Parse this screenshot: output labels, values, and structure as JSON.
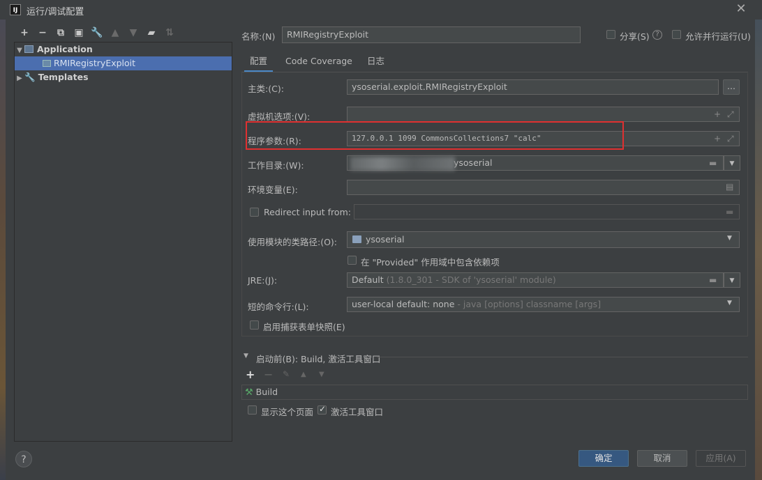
{
  "window": {
    "title": "运行/调试配置",
    "app_icon": "IJ"
  },
  "toolbar": {
    "icons": [
      "add-icon",
      "remove-icon",
      "copy-icon",
      "save-icon",
      "wrench-icon",
      "move-up-icon",
      "move-down-icon",
      "new-folder-icon",
      "sort-icon"
    ]
  },
  "tree": {
    "application": "Application",
    "config": "RMIRegistryExploit",
    "templates": "Templates"
  },
  "header": {
    "name_label": "名称:(N)",
    "name_value": "RMIRegistryExploit",
    "share_label": "分享(S)",
    "parallel_label": "允许并行运行(U)"
  },
  "tabs": [
    "配置",
    "Code Coverage",
    "日志"
  ],
  "form": {
    "main_class_label": "主类:(C):",
    "main_class_value": "ysoserial.exploit.RMIRegistryExploit",
    "vm_options_label": "虚拟机选项:(V):",
    "program_args_label": "程序参数:(R):",
    "program_args_value": "127.0.0.1 1099 CommonsCollections7 \"calc\"",
    "workdir_label": "工作目录:(W):",
    "workdir_value": "ysoserial",
    "env_label": "环境变量(E):",
    "redirect_label": "Redirect input from:",
    "module_label": "使用模块的类路径:(O):",
    "module_value": "ysoserial",
    "provided_label": "在 \"Provided\" 作用域中包含依赖项",
    "jre_label": "JRE:(J):",
    "jre_value": "Default",
    "jre_hint": "(1.8.0_301 - SDK of 'ysoserial' module)",
    "shorten_label": "短的命令行:(L):",
    "shorten_value": "user-local default: none",
    "shorten_hint": "- java [options] classname [args]",
    "snapshot_label": "启用捕获表单快照(E)"
  },
  "before_launch": {
    "title": "启动前(B): Build, 激活工具窗口",
    "item": "Build",
    "show_page_label": "显示这个页面",
    "activate_label": "激活工具窗口"
  },
  "buttons": {
    "ok": "确定",
    "cancel": "取消",
    "apply": "应用(A)"
  },
  "colors": {
    "accent": "#4b6eaf",
    "primary_button": "#365880",
    "highlight_box": "#e03030"
  }
}
